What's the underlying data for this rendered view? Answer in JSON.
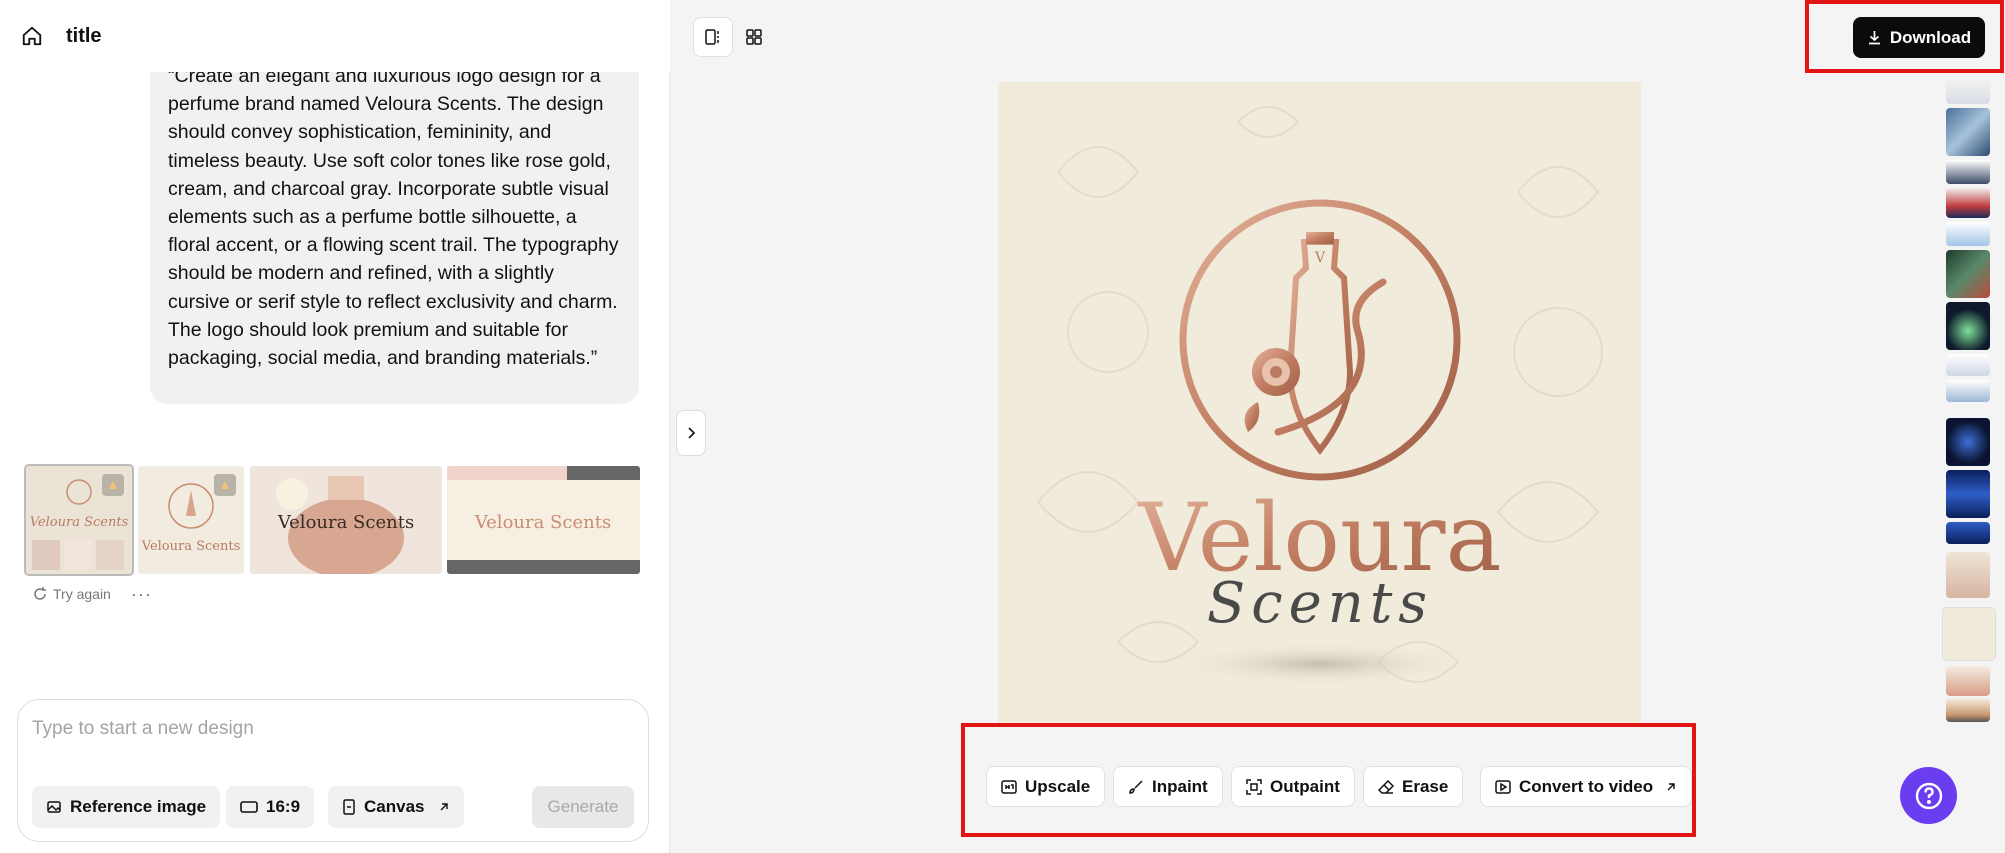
{
  "header": {
    "title": "title"
  },
  "chat": {
    "message": "“Create an elegant and luxurious logo design for a perfume brand named Veloura Scents. The design should convey sophistication, femininity, and timeless beauty. Use soft color tones like rose gold, cream, and charcoal gray. Incorporate subtle visual elements such as a perfume bottle silhouette, a floral accent, or a flowing scent trail. The typography should be modern and refined, with a slightly cursive or serif style to reflect exclusivity and charm. The logo should look premium and suitable for packaging, social media, and branding materials.”",
    "results": [
      {
        "label": "Veloura Scents"
      },
      {
        "label": "Veloura Scents"
      },
      {
        "label": "Veloura Scents"
      },
      {
        "label": "Veloura Scents"
      }
    ],
    "try_again": "Try again",
    "more": "···"
  },
  "composer": {
    "placeholder": "Type to start a new design",
    "reference_image": "Reference image",
    "aspect_ratio": "16:9",
    "canvas": "Canvas",
    "generate": "Generate"
  },
  "toolbar": {
    "download": "Download",
    "upscale": "Upscale",
    "inpaint": "Inpaint",
    "outpaint": "Outpaint",
    "erase": "Erase",
    "convert_to_video": "Convert to video"
  },
  "preview": {
    "brand_line1": "Veloura",
    "brand_line2": "Scents",
    "monogram": "V"
  },
  "colors": {
    "accent_red": "#e31414",
    "help_purple": "#6a3df0",
    "rose_gold": "#c98c70"
  }
}
